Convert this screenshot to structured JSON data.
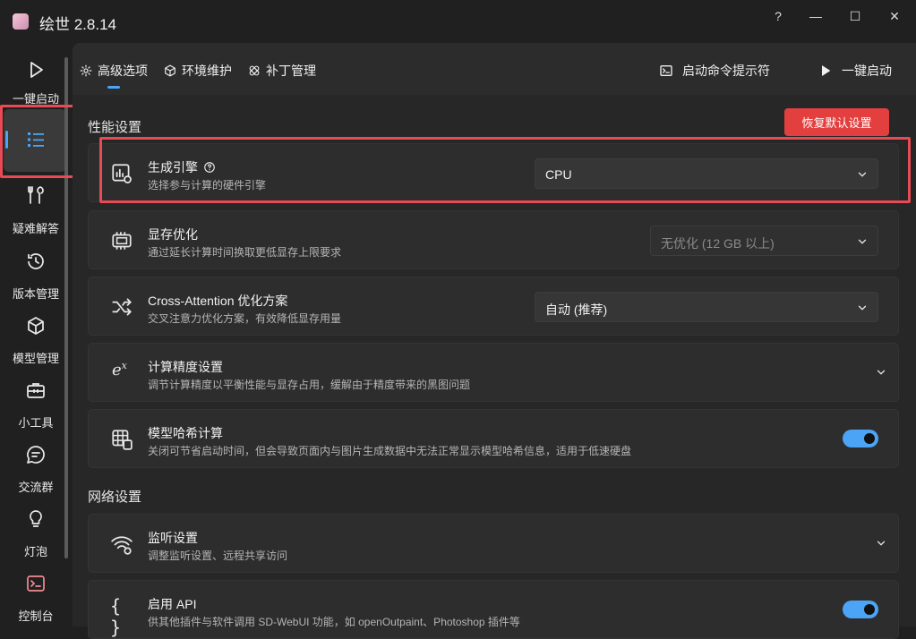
{
  "app": {
    "title": "绘世 2.8.14"
  },
  "window": {
    "help": "?",
    "minimize": "—",
    "maximize": "☐",
    "close": "✕"
  },
  "nav": {
    "items": [
      {
        "label": "一键启动"
      },
      {
        "label": ""
      },
      {
        "label": "疑难解答"
      },
      {
        "label": "版本管理"
      },
      {
        "label": "模型管理"
      },
      {
        "label": "小工具"
      },
      {
        "label": "交流群"
      },
      {
        "label": "灯泡"
      },
      {
        "label": "控制台"
      }
    ]
  },
  "tabs": [
    {
      "label": "高级选项"
    },
    {
      "label": "环境维护"
    },
    {
      "label": "补丁管理"
    }
  ],
  "actions": {
    "cmd_prompt": "启动命令提示符",
    "launch": "一键启动"
  },
  "performance": {
    "title": "性能设置",
    "reset": "恢复默认设置",
    "engine": {
      "title": "生成引擎",
      "desc": "选择参与计算的硬件引擎",
      "value": "CPU"
    },
    "vram": {
      "title": "显存优化",
      "desc": "通过延长计算时间换取更低显存上限要求",
      "value": "无优化 (12 GB 以上)"
    },
    "cross_attention": {
      "title": "Cross-Attention 优化方案",
      "desc": "交叉注意力优化方案，有效降低显存用量",
      "value": "自动 (推荐)"
    },
    "precision": {
      "title": "计算精度设置",
      "desc": "调节计算精度以平衡性能与显存占用，缓解由于精度带来的黑图问题"
    },
    "model_hash": {
      "title": "模型哈希计算",
      "desc": "关闭可节省启动时间，但会导致页面内与图片生成数据中无法正常显示模型哈希信息，适用于低速硬盘",
      "enabled": true
    }
  },
  "network": {
    "title": "网络设置",
    "listen": {
      "title": "监听设置",
      "desc": "调整监听设置、远程共享访问"
    },
    "api": {
      "title": "启用 API",
      "desc": "供其他插件与软件调用 SD-WebUI 功能，如 openOutpaint、Photoshop 插件等",
      "enabled": true
    }
  },
  "colors": {
    "accent": "#4ca4f6",
    "danger": "#e33f3f",
    "highlight": "#e84b55"
  }
}
